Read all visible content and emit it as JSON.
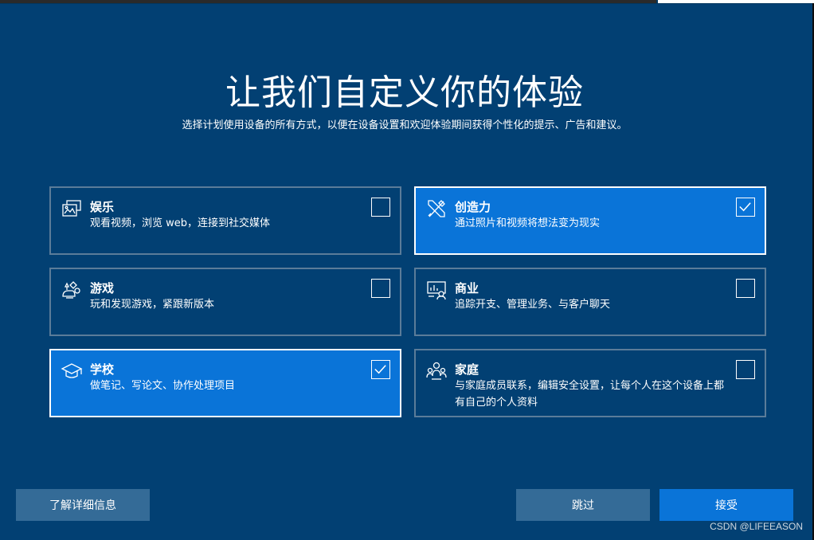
{
  "title": "让我们自定义你的体验",
  "subtitle": "选择计划使用设备的所有方式，以便在设备设置和欢迎体验期间获得个性化的提示、广告和建议。",
  "cards": [
    {
      "label": "娱乐",
      "desc": "观看视频，浏览 web，连接到社交媒体",
      "icon": "entertainment-icon",
      "selected": false
    },
    {
      "label": "创造力",
      "desc": "通过照片和视频将想法变为现实",
      "icon": "creativity-icon",
      "selected": true
    },
    {
      "label": "游戏",
      "desc": "玩和发现游戏，紧跟新版本",
      "icon": "gaming-icon",
      "selected": false
    },
    {
      "label": "商业",
      "desc": "追踪开支、管理业务、与客户聊天",
      "icon": "business-icon",
      "selected": false
    },
    {
      "label": "学校",
      "desc": "做笔记、写论文、协作处理项目",
      "icon": "school-icon",
      "selected": true
    },
    {
      "label": "家庭",
      "desc": "与家庭成员联系，编辑安全设置，让每个人在这个设备上都有自己的个人资料",
      "icon": "family-icon",
      "selected": false
    }
  ],
  "buttons": {
    "learn_more": "了解详细信息",
    "skip": "跳过",
    "accept": "接受"
  },
  "watermark": "CSDN @LIFEEASON",
  "colors": {
    "background": "#024073",
    "selected_card": "#0a74d8",
    "secondary_button": "#346b97",
    "primary_button": "#0a74d8"
  }
}
